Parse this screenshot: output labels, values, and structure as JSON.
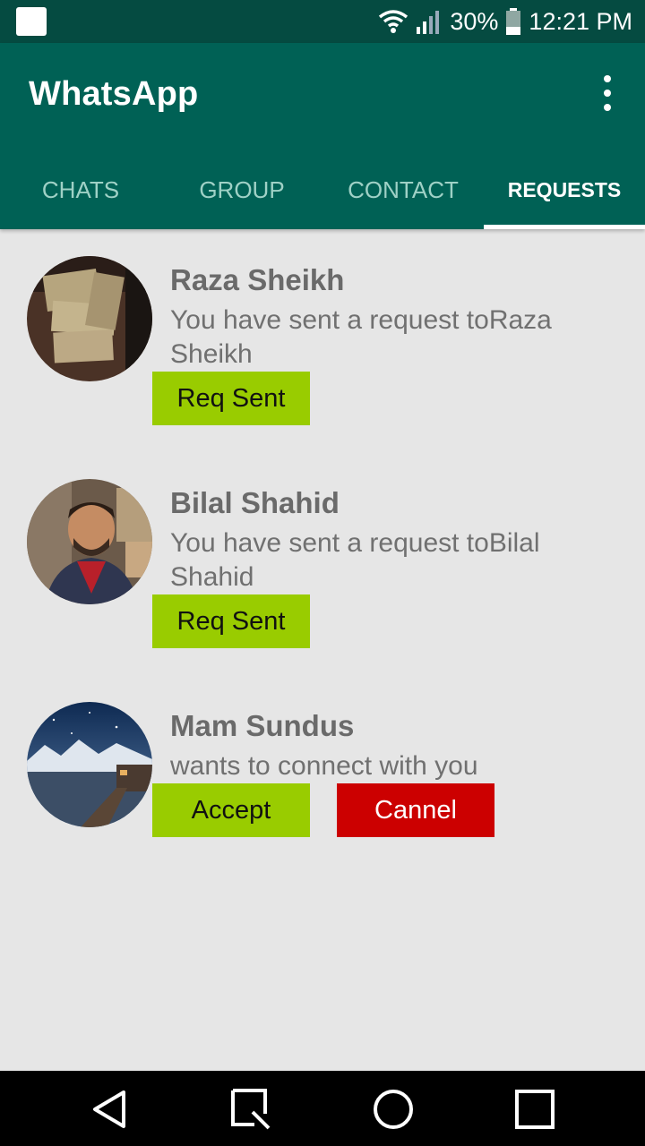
{
  "status_bar": {
    "battery": "30%",
    "time": "12:21 PM"
  },
  "app": {
    "title": "WhatsApp"
  },
  "tabs": [
    {
      "label": "CHATS"
    },
    {
      "label": "GROUP"
    },
    {
      "label": "CONTACT"
    },
    {
      "label": "REQUESTS",
      "active": true
    }
  ],
  "requests": [
    {
      "name": "Raza Sheikh",
      "message": "You have sent a request toRaza Sheikh",
      "buttons": [
        {
          "label": "Req Sent"
        }
      ]
    },
    {
      "name": "Bilal Shahid",
      "message": "You have sent a request toBilal Shahid",
      "buttons": [
        {
          "label": "Req Sent"
        }
      ]
    },
    {
      "name": "Mam Sundus",
      "message": "wants to connect with you",
      "buttons": [
        {
          "label": "Accept"
        },
        {
          "label": "Cannel"
        }
      ]
    }
  ],
  "colors": {
    "status_bar": "#054b41",
    "app_bar": "#006155",
    "accept_green": "#99cc00",
    "cancel_red": "#cc0000"
  },
  "icons": [
    "notification-icon",
    "wifi-icon",
    "signal-icon",
    "battery-icon",
    "overflow-menu-icon",
    "back-icon",
    "recents-search-icon",
    "home-icon",
    "overview-icon"
  ]
}
